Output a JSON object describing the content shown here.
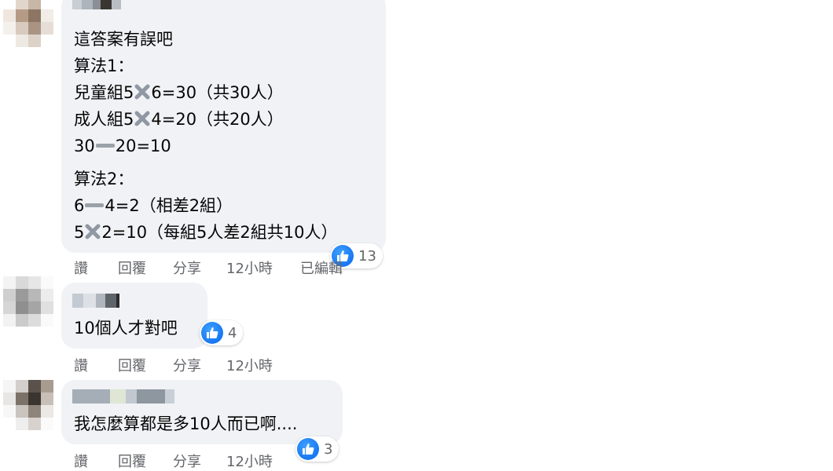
{
  "comments": [
    {
      "lines": [
        "這答案有誤吧",
        "算法1：",
        "兒童組5",
        "6=30（共30人）",
        "成人組5",
        "4=20（共20人）",
        "30",
        "20=10",
        "算法2：",
        "6",
        "4=2（相差2組）",
        "5",
        "2=10（每組5人差2組共10人）"
      ],
      "reactions": "13",
      "actions": {
        "like": "讚",
        "reply": "回覆",
        "share": "分享",
        "time": "12小時",
        "edited": "已編輯"
      }
    },
    {
      "lines": [
        "10個人才對吧"
      ],
      "reactions": "4",
      "actions": {
        "like": "讚",
        "reply": "回覆",
        "share": "分享",
        "time": "12小時"
      }
    },
    {
      "lines": [
        "我怎麼算都是多10人而已啊...."
      ],
      "reactions": "3",
      "actions": {
        "like": "讚",
        "reply": "回覆",
        "share": "分享",
        "time": "12小時"
      }
    }
  ],
  "icons": {
    "reaction": "like-icon",
    "operator": "multiply-icon",
    "minus": "minus-icon"
  },
  "colors": {
    "bubble": "#f0f2f5",
    "like": "#1877f2",
    "meta": "#65676b"
  }
}
